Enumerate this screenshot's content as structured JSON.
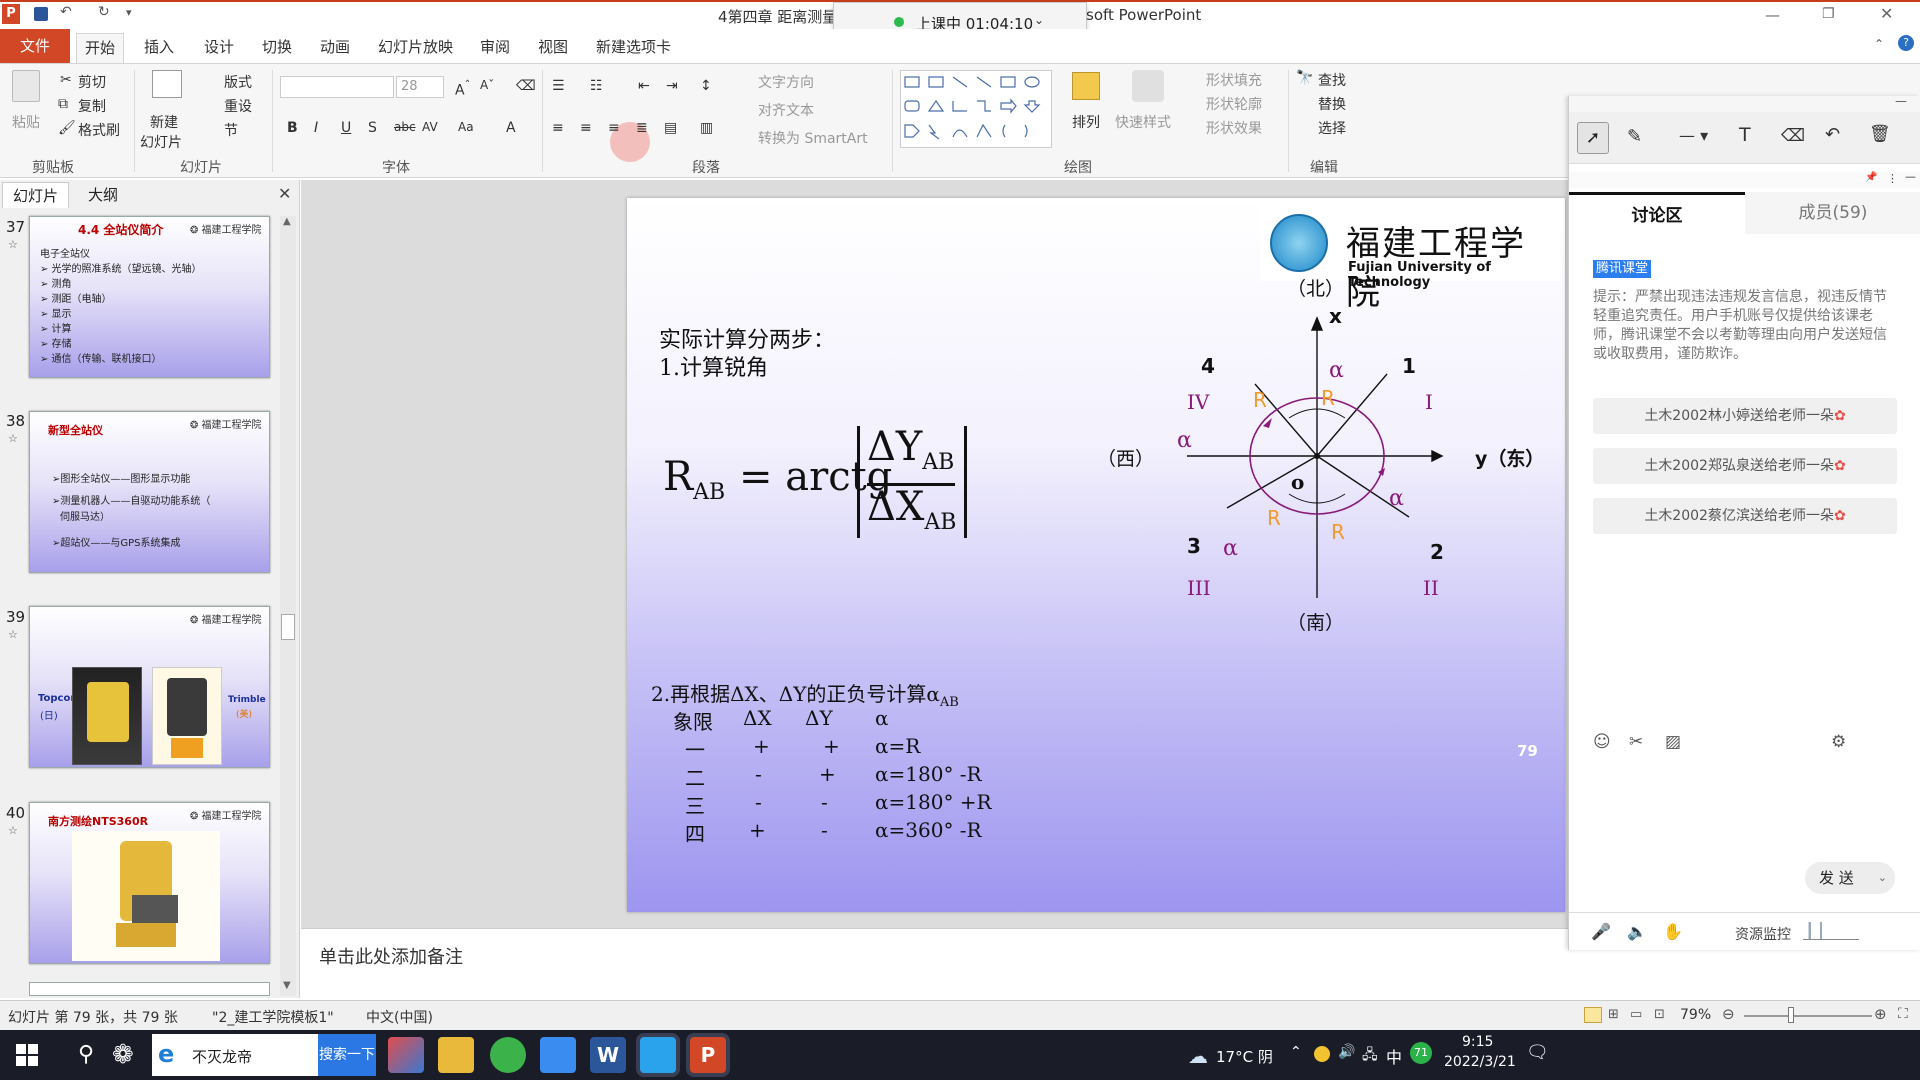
{
  "window": {
    "title_left": "4第四章 距离测量",
    "title_right": "soft PowerPoint",
    "class_timer": "上课中 01:04:10"
  },
  "tabs": [
    "文件",
    "开始",
    "插入",
    "设计",
    "切换",
    "动画",
    "幻灯片放映",
    "审阅",
    "视图",
    "新建选项卡"
  ],
  "ribbon": {
    "paste": "粘贴",
    "cut": "剪切",
    "copy": "复制",
    "format_painter": "格式刷",
    "clipboard_group": "剪贴板",
    "new_slide": "新建",
    "new_slide2": "幻灯片",
    "layout": "版式",
    "reset": "重设",
    "section": "节",
    "slides_group": "幻灯片",
    "font_size": "28",
    "font_group": "字体",
    "text_direction": "文字方向",
    "align_text": "对齐文本",
    "smartart": "转换为 SmartArt",
    "paragraph_group": "段落",
    "arrange": "排列",
    "quick_styles": "快速样式",
    "shape_fill": "形状填充",
    "shape_outline": "形状轮廓",
    "shape_effects": "形状效果",
    "drawing_group": "绘图",
    "find": "查找",
    "replace": "替换",
    "select": "选择",
    "editing_group": "编辑"
  },
  "left_panel": {
    "tab_slides": "幻灯片",
    "tab_outline": "大纲",
    "close": "✕",
    "thumbnails": [
      {
        "num": "37",
        "title": "4.4 全站仪简介",
        "lines": [
          "电子全站仪",
          "➢ 光学的照准系统（望远镜、光轴）",
          "➢ 测角",
          "➢ 测距（电轴）",
          "➢ 显示",
          "➢ 计算",
          "➢ 存储",
          "➢ 通信（传输、联机接口）"
        ]
      },
      {
        "num": "38",
        "title": "新型全站仪",
        "lines": [
          "➢图形全站仪——图形显示功能",
          "➢测量机器人——自驱动功能系统（",
          "伺服马达）",
          "➢超站仪——与GPS系统集成"
        ]
      },
      {
        "num": "39",
        "title": "",
        "lines": [
          "Topcon",
          "(日)",
          "Trimble",
          "(美)"
        ]
      },
      {
        "num": "40",
        "title": "南方测绘NTS360R",
        "lines": []
      }
    ]
  },
  "slide": {
    "logo_cn": "福建工程学院",
    "logo_en": "Fujian University of Technology",
    "heading1": "实际计算分两步：",
    "heading2": "1.计算锐角",
    "formula_lhs": "R",
    "formula_lhs_sub": "AB",
    "formula_eq": "= arctg",
    "formula_num": "ΔY",
    "formula_num_sub": "AB",
    "formula_den": "ΔX",
    "formula_den_sub": "AB",
    "step2": "2.再根据ΔX、ΔY的正负号计算α",
    "step2_sub": "AB",
    "table_header": [
      "象限",
      "ΔX",
      "ΔY",
      "α"
    ],
    "table_rows": [
      [
        "一",
        "+",
        "+",
        "α=R"
      ],
      [
        "二",
        "-",
        "+",
        "α=180° -R"
      ],
      [
        "三",
        "-",
        "-",
        "α=180° +R"
      ],
      [
        "四",
        "+",
        "-",
        "α=360° -R"
      ]
    ],
    "page_num": "79",
    "diagram": {
      "north": "（北）",
      "south": "（南）",
      "west": "（西）",
      "east": "y（东）",
      "x_axis": "x",
      "origin": "o",
      "points": [
        "1",
        "2",
        "3",
        "4"
      ],
      "quadrants": [
        "I",
        "II",
        "III",
        "IV"
      ],
      "alpha": "α",
      "r": "R"
    }
  },
  "notes_placeholder": "单击此处添加备注",
  "status": {
    "slide_info": "幻灯片 第 79 张，共 79 张",
    "template": "\"2_建工学院模板1\"",
    "lang": "中文(中国)",
    "zoom": "79%"
  },
  "chat": {
    "tab_discussion": "讨论区",
    "tab_members": "成员(59)",
    "badge": "腾讯课堂",
    "notice": "提示：严禁出现违法违规发言信息，视违反情节轻重追究责任。用户手机账号仅提供给该课老师，腾讯课堂不会以考勤等理由向用户发送短信或收取费用，谨防欺诈。",
    "messages": [
      "土木2002林小婷送给老师一朵",
      "土木2002郑弘泉送给老师一朵",
      "土木2002蔡亿滨送给老师一朵"
    ],
    "send": "发 送",
    "monitor": "资源监控"
  },
  "taskbar": {
    "app_title": "不灭龙帝",
    "search_btn": "搜索一下",
    "weather": "17°C 阴",
    "ime": "中",
    "badge_num": "71",
    "time": "9:15",
    "date": "2022/3/21"
  }
}
